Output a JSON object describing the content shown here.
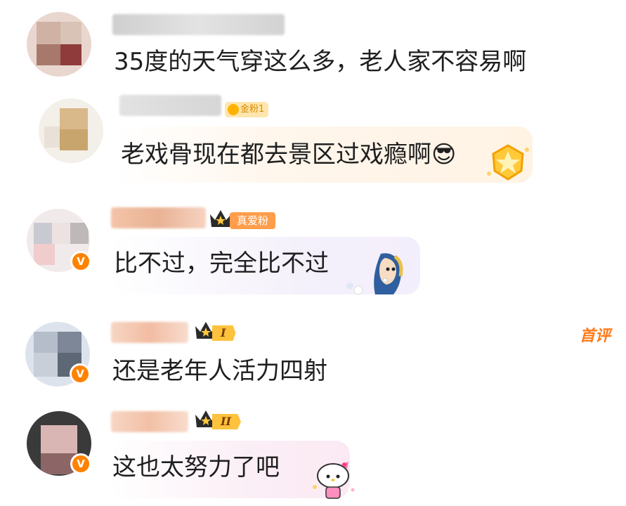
{
  "comments": [
    {
      "text": "35度的天气穿这么多，老人家不容易啊"
    },
    {
      "text": "老戏骨现在都去景区过戏瘾啊😎",
      "badge": "金粉1"
    },
    {
      "text": "比不过，完全比不过",
      "badge": "真爱粉"
    },
    {
      "text": "还是老年人活力四射",
      "level": "I",
      "tag": "首评"
    },
    {
      "text": "这也太努力了吧",
      "level": "II"
    }
  ],
  "colors": {
    "accent": "#ff8200",
    "badge_gold": "#ffc23d",
    "tag_orange": "#ff7a1a"
  }
}
